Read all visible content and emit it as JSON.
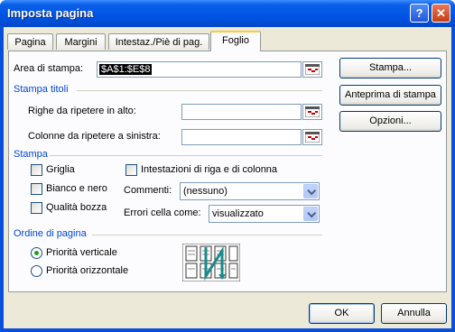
{
  "window": {
    "title": "Imposta pagina"
  },
  "tabs": [
    "Pagina",
    "Margini",
    "Intestaz./Piè di pag.",
    "Foglio"
  ],
  "print_area": {
    "label": "Area di stampa:",
    "value": "$A$1:$E$8"
  },
  "print_titles": {
    "group": "Stampa titoli",
    "rows_label": "Righe da ripetere in alto:",
    "rows_value": "",
    "cols_label": "Colonne da ripetere a sinistra:",
    "cols_value": ""
  },
  "print": {
    "group": "Stampa",
    "gridlines": "Griglia",
    "bw": "Bianco e nero",
    "draft": "Qualità bozza",
    "headings": "Intestazioni di riga e di colonna",
    "comments_label": "Commenti:",
    "comments_value": "(nessuno)",
    "errors_label": "Errori cella come:",
    "errors_value": "visualizzato"
  },
  "order": {
    "group": "Ordine di pagina",
    "down": "Priorità verticale",
    "over": "Priorità orizzontale",
    "selected": "down"
  },
  "side_buttons": {
    "print": "Stampa...",
    "preview": "Anteprima di stampa",
    "options": "Opzioni..."
  },
  "footer": {
    "ok": "OK",
    "cancel": "Annulla"
  },
  "colors": {
    "title_bar": "#0054e3",
    "group_text": "#0046d5",
    "dialog_bg": "#ece9d8"
  },
  "icons": [
    "help-icon",
    "close-icon",
    "collapse-dialog-icon",
    "page-order-icon"
  ]
}
